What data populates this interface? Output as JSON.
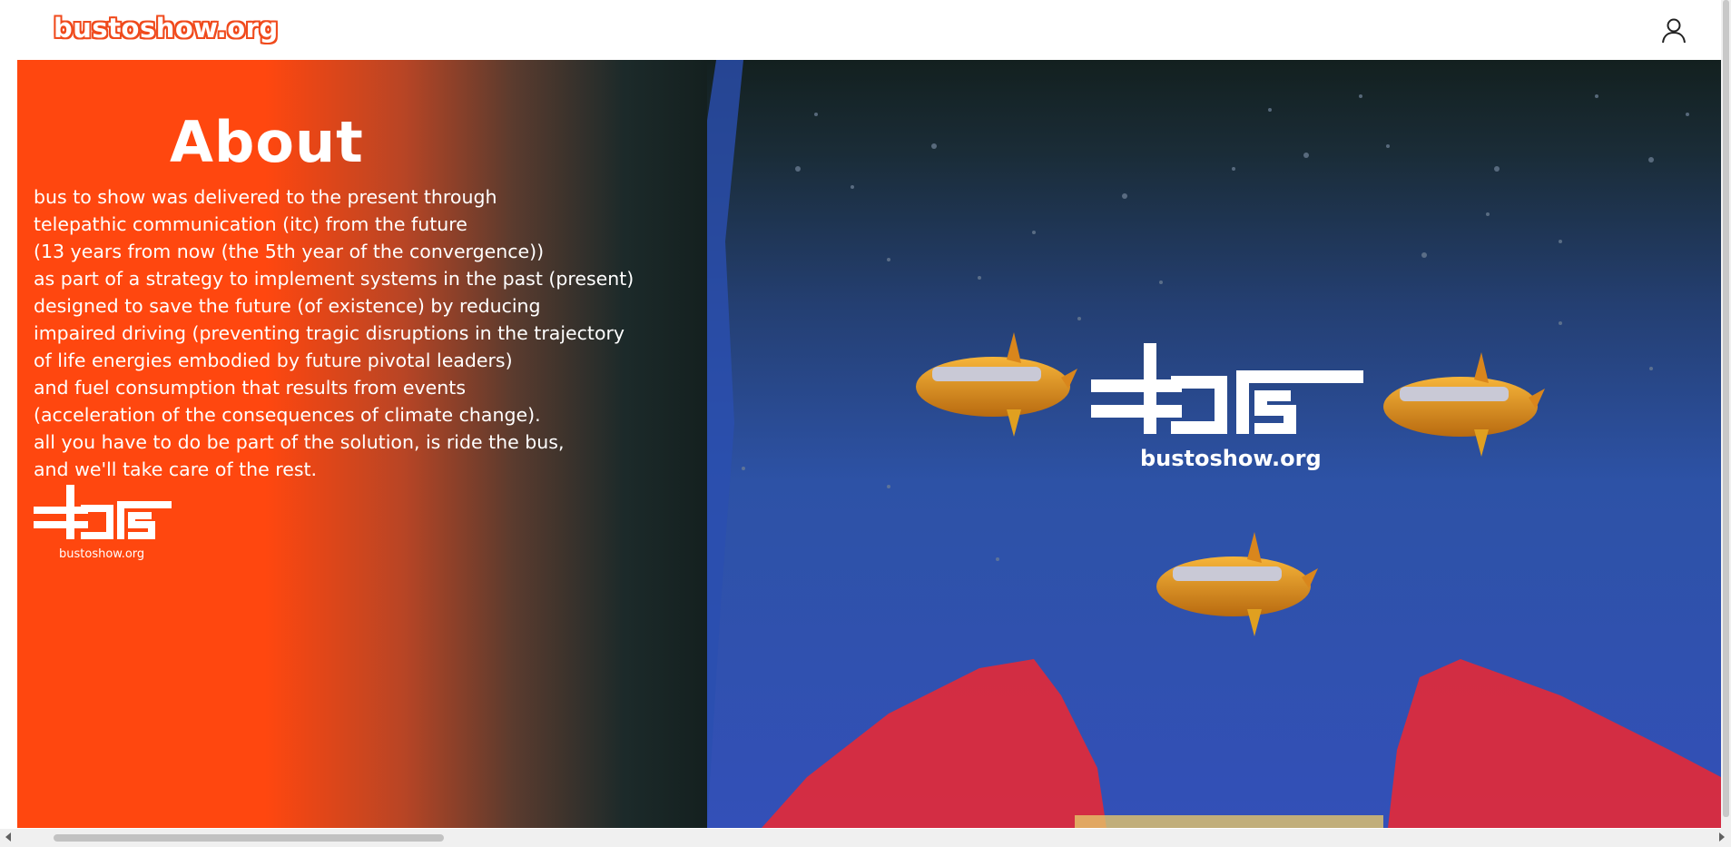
{
  "header": {
    "brand": "bustoshow.org",
    "user_icon": "user-icon"
  },
  "about": {
    "title": "About",
    "lines": [
      "bus to show was delivered to the present through",
      "telepathic communication (itc) from the future",
      "(13 years from now (the 5th year of the convergence))",
      "as part of a strategy to implement systems in the past (present)",
      "designed to save the future (of existence) by reducing",
      "impaired driving (preventing tragic disruptions in the trajectory",
      "of life energies embodied by future pivotal leaders)",
      "and fuel consumption that results from events",
      "(acceleration of the consequences of climate change).",
      "all you have to do be part of the solution, is ride the bus,",
      "and we'll take care of the rest."
    ],
    "logo_caption": "bustoshow.org"
  },
  "hero": {
    "logo_caption": "bustoshow.org"
  },
  "colors": {
    "accent": "#ff4a0f",
    "sky_dark": "#14201f",
    "sky_blue": "#2f56b0",
    "flames": "#e8283a"
  }
}
